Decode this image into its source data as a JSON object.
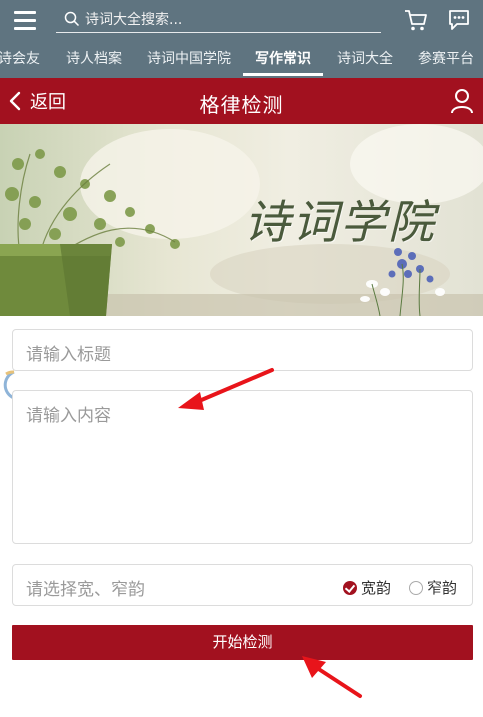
{
  "topbar": {
    "menu_icon": "hamburger-menu-icon",
    "search_placeholder": "诗词大全搜索...",
    "cart_icon": "cart-icon",
    "chat_icon": "chat-icon"
  },
  "tabs": [
    {
      "label": "诗会友"
    },
    {
      "label": "诗人档案"
    },
    {
      "label": "诗词中国学院"
    },
    {
      "label": "写作常识",
      "active": true
    },
    {
      "label": "诗词大全"
    },
    {
      "label": "参赛平台"
    }
  ],
  "header": {
    "back_label": "返回",
    "title": "格律检测",
    "accent_color": "#a2111f"
  },
  "banner": {
    "calligraphy_text": "诗词学院"
  },
  "form": {
    "title_placeholder": "请输入标题",
    "content_placeholder": "请输入内容",
    "rhyme_placeholder": "请选择宽、窄韵",
    "rhyme_options": [
      {
        "label": "宽韵",
        "selected": true
      },
      {
        "label": "窄韵",
        "selected": false
      }
    ],
    "submit_label": "开始检测"
  },
  "annotations": {
    "arrow_color": "#e8141a"
  }
}
